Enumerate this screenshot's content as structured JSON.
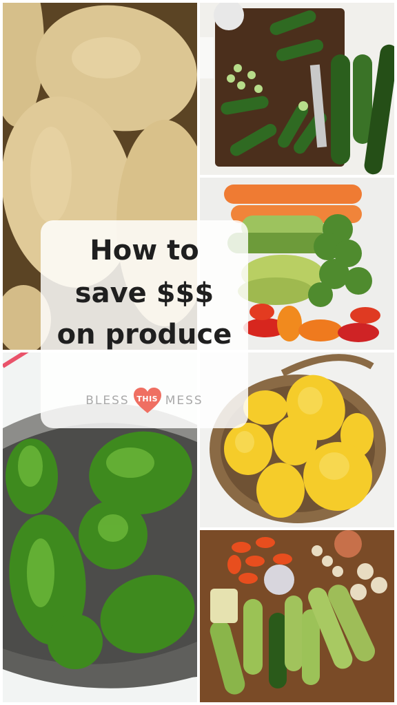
{
  "headline": {
    "line1": "How to",
    "line2": "save $$$",
    "line3": "on produce"
  },
  "logo": {
    "left": "BLESS",
    "heart_text": "THIS",
    "right": "MESS",
    "heart_color": "#ef6f62",
    "text_color": "#a9a9a9"
  },
  "tiles": [
    {
      "subject": "potatoes"
    },
    {
      "subject": "cucumbers"
    },
    {
      "subject": "carrots, cucumbers, broccoli and mini peppers"
    },
    {
      "subject": "green bell peppers in a colander"
    },
    {
      "subject": "spaghetti squash in a basket"
    },
    {
      "subject": "zucchini, peppers and mushrooms"
    }
  ]
}
